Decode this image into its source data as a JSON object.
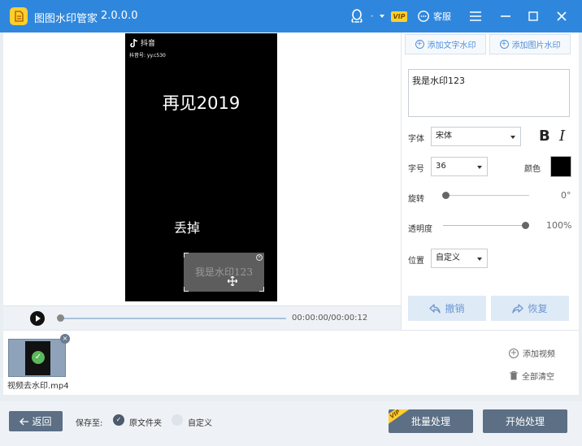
{
  "app": {
    "title": "图图水印管家",
    "version": "2.0.0.0",
    "vip_label": "VIP",
    "customer_service": "客服"
  },
  "colors": {
    "titlebar": "#2f87dd",
    "accent": "#4f8fd9",
    "dark_button": "#5c6f85"
  },
  "preview": {
    "douyin_brand": "抖音",
    "douyin_id": "抖音号: yy.c530",
    "video_title": "再见2019",
    "video_subtitle": "丢掉",
    "watermark_text": "我是水印123"
  },
  "player": {
    "time": "00:00:00/00:00:12"
  },
  "panel": {
    "add_text_watermark": "添加文字水印",
    "add_image_watermark": "添加图片水印",
    "watermark_text_value": "我是水印123",
    "font_label": "字体",
    "font_value": "宋体",
    "bold_glyph": "B",
    "italic_glyph": "I",
    "size_label": "字号",
    "size_value": "36",
    "color_label": "颜色",
    "color_value": "#000000",
    "rotate_label": "旋转",
    "rotate_value": "0°",
    "opacity_label": "透明度",
    "opacity_value": "100%",
    "position_label": "位置",
    "position_value": "自定义",
    "undo_label": "撤销",
    "redo_label": "恢复"
  },
  "list": {
    "items": [
      {
        "name": "视频去水印.mp4"
      }
    ],
    "add_video": "添加视频",
    "clear_all": "全部清空"
  },
  "bottom": {
    "back_label": "返回",
    "save_to_label": "保存至:",
    "option_original": "原文件夹",
    "option_custom": "自定义",
    "batch_label": "批量处理",
    "batch_vip_tag": "VIP",
    "start_label": "开始处理"
  }
}
